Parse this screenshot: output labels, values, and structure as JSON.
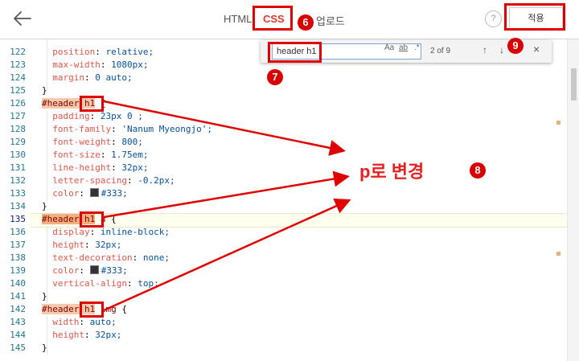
{
  "header": {
    "tabs": [
      {
        "label": "HTML"
      },
      {
        "label": "CSS"
      },
      {
        "label": "업로드"
      }
    ],
    "help_label": "?",
    "apply_label": "적용"
  },
  "find_widget": {
    "query": "header h1",
    "option_case": "Aa",
    "option_word": "ab",
    "option_regex": ".*",
    "count": "2 of 9",
    "prev": "↑",
    "next": "↓",
    "close": "×"
  },
  "code_lines": [
    {
      "num": "122",
      "code": "  position: relative;"
    },
    {
      "num": "123",
      "code": "  max-width: 1080px;"
    },
    {
      "num": "124",
      "code": "  margin: 0 auto;"
    },
    {
      "num": "125",
      "code": "}"
    },
    {
      "num": "126",
      "code": "#header h1 {"
    },
    {
      "num": "127",
      "code": "  padding: 23px 0 ;"
    },
    {
      "num": "128",
      "code": "  font-family: 'Nanum Myeongjo';"
    },
    {
      "num": "129",
      "code": "  font-weight: 800;"
    },
    {
      "num": "130",
      "code": "  font-size: 1.75em;"
    },
    {
      "num": "131",
      "code": "  line-height: 32px;"
    },
    {
      "num": "132",
      "code": "  letter-spacing: -0.2px;"
    },
    {
      "num": "133",
      "code": "  color: #333;"
    },
    {
      "num": "134",
      "code": "}"
    },
    {
      "num": "135",
      "code": "#header h1 a {"
    },
    {
      "num": "136",
      "code": "  display: inline-block;"
    },
    {
      "num": "137",
      "code": "  height: 32px;"
    },
    {
      "num": "138",
      "code": "  text-decoration: none;"
    },
    {
      "num": "139",
      "code": "  color: #333;"
    },
    {
      "num": "140",
      "code": "  vertical-align: top;"
    },
    {
      "num": "141",
      "code": "}"
    },
    {
      "num": "142",
      "code": "#header h1 img {"
    },
    {
      "num": "143",
      "code": "  width: auto;"
    },
    {
      "num": "144",
      "code": "  height: 32px;"
    },
    {
      "num": "145",
      "code": "}"
    }
  ],
  "annotations": {
    "badge_6": "6",
    "badge_7": "7",
    "badge_8": "8",
    "badge_9": "9",
    "note_text": "p로 변경"
  },
  "colors": {
    "accent": "#e0392b",
    "annotation_red": "#e00000",
    "match_highlight": "#f8c9ab",
    "line_number": "#237893"
  }
}
